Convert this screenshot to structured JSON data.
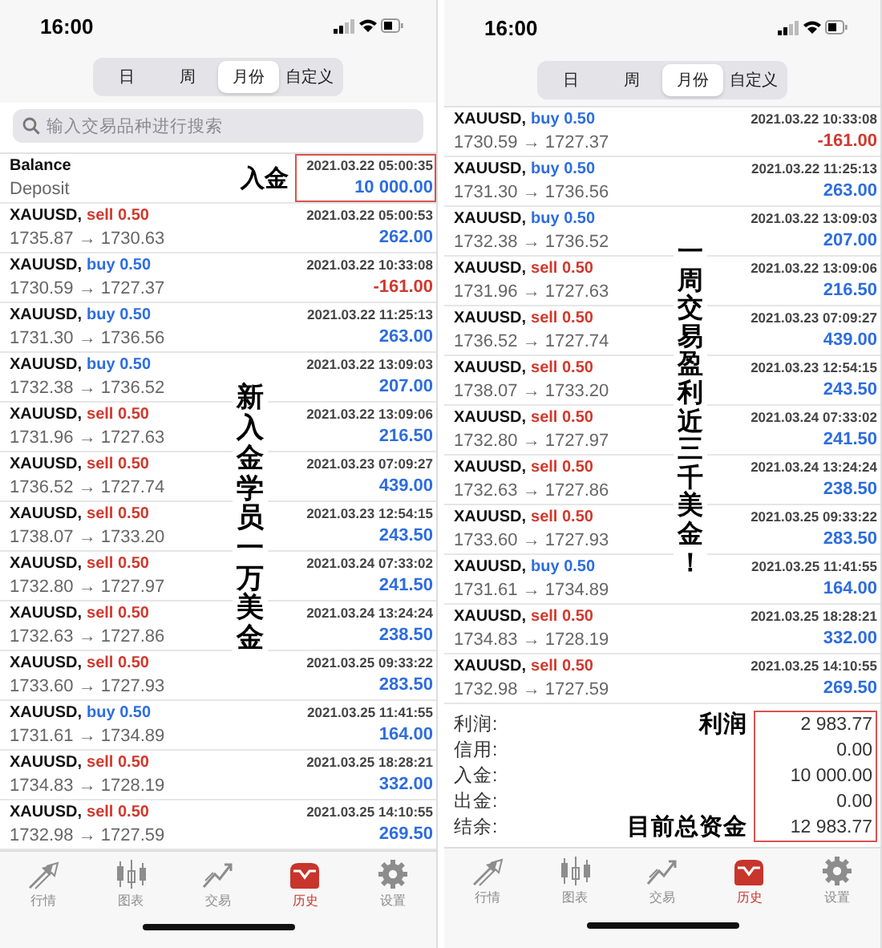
{
  "screens": [
    {
      "status_time": "16:00",
      "periods": [
        {
          "label": "日",
          "selected": false
        },
        {
          "label": "周",
          "selected": false
        },
        {
          "label": "月份",
          "selected": true
        },
        {
          "label": "自定义",
          "selected": false
        }
      ],
      "search": {
        "placeholder": "输入交易品种进行搜索"
      },
      "caption": "新入金学员一万美金",
      "rows": [
        {
          "kind": "balance",
          "title": "Balance",
          "subtitle": "Deposit",
          "note": "入金",
          "boxed": true,
          "date": "2021.03.22 05:00:35",
          "amount": "10 000.00",
          "loss": false
        },
        {
          "kind": "trade",
          "symbol": "XAUUSD,",
          "sell": true,
          "order": "sell 0.50",
          "prices": "1735.87 → 1730.63",
          "date": "2021.03.22 05:00:53",
          "amount": "262.00",
          "loss": false
        },
        {
          "kind": "trade",
          "symbol": "XAUUSD,",
          "sell": false,
          "order": "buy 0.50",
          "prices": "1730.59 → 1727.37",
          "date": "2021.03.22 10:33:08",
          "amount": "-161.00",
          "loss": true
        },
        {
          "kind": "trade",
          "symbol": "XAUUSD,",
          "sell": false,
          "order": "buy 0.50",
          "prices": "1731.30 → 1736.56",
          "date": "2021.03.22 11:25:13",
          "amount": "263.00",
          "loss": false
        },
        {
          "kind": "trade",
          "symbol": "XAUUSD,",
          "sell": false,
          "order": "buy 0.50",
          "prices": "1732.38 → 1736.52",
          "date": "2021.03.22 13:09:03",
          "amount": "207.00",
          "loss": false
        },
        {
          "kind": "trade",
          "symbol": "XAUUSD,",
          "sell": true,
          "order": "sell 0.50",
          "prices": "1731.96 → 1727.63",
          "date": "2021.03.22 13:09:06",
          "amount": "216.50",
          "loss": false
        },
        {
          "kind": "trade",
          "symbol": "XAUUSD,",
          "sell": true,
          "order": "sell 0.50",
          "prices": "1736.52 → 1727.74",
          "date": "2021.03.23 07:09:27",
          "amount": "439.00",
          "loss": false
        },
        {
          "kind": "trade",
          "symbol": "XAUUSD,",
          "sell": true,
          "order": "sell 0.50",
          "prices": "1738.07 → 1733.20",
          "date": "2021.03.23 12:54:15",
          "amount": "243.50",
          "loss": false
        },
        {
          "kind": "trade",
          "symbol": "XAUUSD,",
          "sell": true,
          "order": "sell 0.50",
          "prices": "1732.80 → 1727.97",
          "date": "2021.03.24 07:33:02",
          "amount": "241.50",
          "loss": false
        },
        {
          "kind": "trade",
          "symbol": "XAUUSD,",
          "sell": true,
          "order": "sell 0.50",
          "prices": "1732.63 → 1727.86",
          "date": "2021.03.24 13:24:24",
          "amount": "238.50",
          "loss": false
        },
        {
          "kind": "trade",
          "symbol": "XAUUSD,",
          "sell": true,
          "order": "sell 0.50",
          "prices": "1733.60 → 1727.93",
          "date": "2021.03.25 09:33:22",
          "amount": "283.50",
          "loss": false
        },
        {
          "kind": "trade",
          "symbol": "XAUUSD,",
          "sell": false,
          "order": "buy 0.50",
          "prices": "1731.61 → 1734.89",
          "date": "2021.03.25 11:41:55",
          "amount": "164.00",
          "loss": false
        },
        {
          "kind": "trade",
          "symbol": "XAUUSD,",
          "sell": true,
          "order": "sell 0.50",
          "prices": "1734.83 → 1728.19",
          "date": "2021.03.25 18:28:21",
          "amount": "332.00",
          "loss": false
        },
        {
          "kind": "trade",
          "symbol": "XAUUSD,",
          "sell": true,
          "order": "sell 0.50",
          "prices": "1732.98 → 1727.59",
          "date": "2021.03.25 14:10:55",
          "amount": "269.50",
          "loss": false
        }
      ],
      "tabbar": [
        {
          "label": "行情",
          "selected": false
        },
        {
          "label": "图表",
          "selected": false
        },
        {
          "label": "交易",
          "selected": false
        },
        {
          "label": "历史",
          "selected": true
        },
        {
          "label": "设置",
          "selected": false
        }
      ]
    },
    {
      "status_time": "16:00",
      "periods": [
        {
          "label": "日",
          "selected": false
        },
        {
          "label": "周",
          "selected": false
        },
        {
          "label": "月份",
          "selected": true
        },
        {
          "label": "自定义",
          "selected": false
        }
      ],
      "caption": "一周交易盈利近三千美金！",
      "rows": [
        {
          "kind": "trade",
          "symbol": "XAUUSD,",
          "sell": false,
          "order": "buy 0.50",
          "prices": "1730.59 → 1727.37",
          "date": "2021.03.22 10:33:08",
          "amount": "-161.00",
          "loss": true
        },
        {
          "kind": "trade",
          "symbol": "XAUUSD,",
          "sell": false,
          "order": "buy 0.50",
          "prices": "1731.30 → 1736.56",
          "date": "2021.03.22 11:25:13",
          "amount": "263.00",
          "loss": false
        },
        {
          "kind": "trade",
          "symbol": "XAUUSD,",
          "sell": false,
          "order": "buy 0.50",
          "prices": "1732.38 → 1736.52",
          "date": "2021.03.22 13:09:03",
          "amount": "207.00",
          "loss": false
        },
        {
          "kind": "trade",
          "symbol": "XAUUSD,",
          "sell": true,
          "order": "sell 0.50",
          "prices": "1731.96 → 1727.63",
          "date": "2021.03.22 13:09:06",
          "amount": "216.50",
          "loss": false
        },
        {
          "kind": "trade",
          "symbol": "XAUUSD,",
          "sell": true,
          "order": "sell 0.50",
          "prices": "1736.52 → 1727.74",
          "date": "2021.03.23 07:09:27",
          "amount": "439.00",
          "loss": false
        },
        {
          "kind": "trade",
          "symbol": "XAUUSD,",
          "sell": true,
          "order": "sell 0.50",
          "prices": "1738.07 → 1733.20",
          "date": "2021.03.23 12:54:15",
          "amount": "243.50",
          "loss": false
        },
        {
          "kind": "trade",
          "symbol": "XAUUSD,",
          "sell": true,
          "order": "sell 0.50",
          "prices": "1732.80 → 1727.97",
          "date": "2021.03.24 07:33:02",
          "amount": "241.50",
          "loss": false
        },
        {
          "kind": "trade",
          "symbol": "XAUUSD,",
          "sell": true,
          "order": "sell 0.50",
          "prices": "1732.63 → 1727.86",
          "date": "2021.03.24 13:24:24",
          "amount": "238.50",
          "loss": false
        },
        {
          "kind": "trade",
          "symbol": "XAUUSD,",
          "sell": true,
          "order": "sell 0.50",
          "prices": "1733.60 → 1727.93",
          "date": "2021.03.25 09:33:22",
          "amount": "283.50",
          "loss": false
        },
        {
          "kind": "trade",
          "symbol": "XAUUSD,",
          "sell": false,
          "order": "buy 0.50",
          "prices": "1731.61 → 1734.89",
          "date": "2021.03.25 11:41:55",
          "amount": "164.00",
          "loss": false
        },
        {
          "kind": "trade",
          "symbol": "XAUUSD,",
          "sell": true,
          "order": "sell 0.50",
          "prices": "1734.83 → 1728.19",
          "date": "2021.03.25 18:28:21",
          "amount": "332.00",
          "loss": false
        },
        {
          "kind": "trade",
          "symbol": "XAUUSD,",
          "sell": true,
          "order": "sell 0.50",
          "prices": "1732.98 → 1727.59",
          "date": "2021.03.25 14:10:55",
          "amount": "269.50",
          "loss": false
        }
      ],
      "summary": {
        "boxed": true,
        "rows": [
          {
            "label": "利润:",
            "note": "利润",
            "value": "2 983.77"
          },
          {
            "label": "信用:",
            "value": "0.00"
          },
          {
            "label": "入金:",
            "value": "10 000.00"
          },
          {
            "label": "出金:",
            "value": "0.00"
          },
          {
            "label": "结余:",
            "note": "目前总资金",
            "value": "12 983.77"
          }
        ]
      },
      "tabbar": [
        {
          "label": "行情",
          "selected": false
        },
        {
          "label": "图表",
          "selected": false
        },
        {
          "label": "交易",
          "selected": false
        },
        {
          "label": "历史",
          "selected": true
        },
        {
          "label": "设置",
          "selected": false
        }
      ]
    }
  ]
}
